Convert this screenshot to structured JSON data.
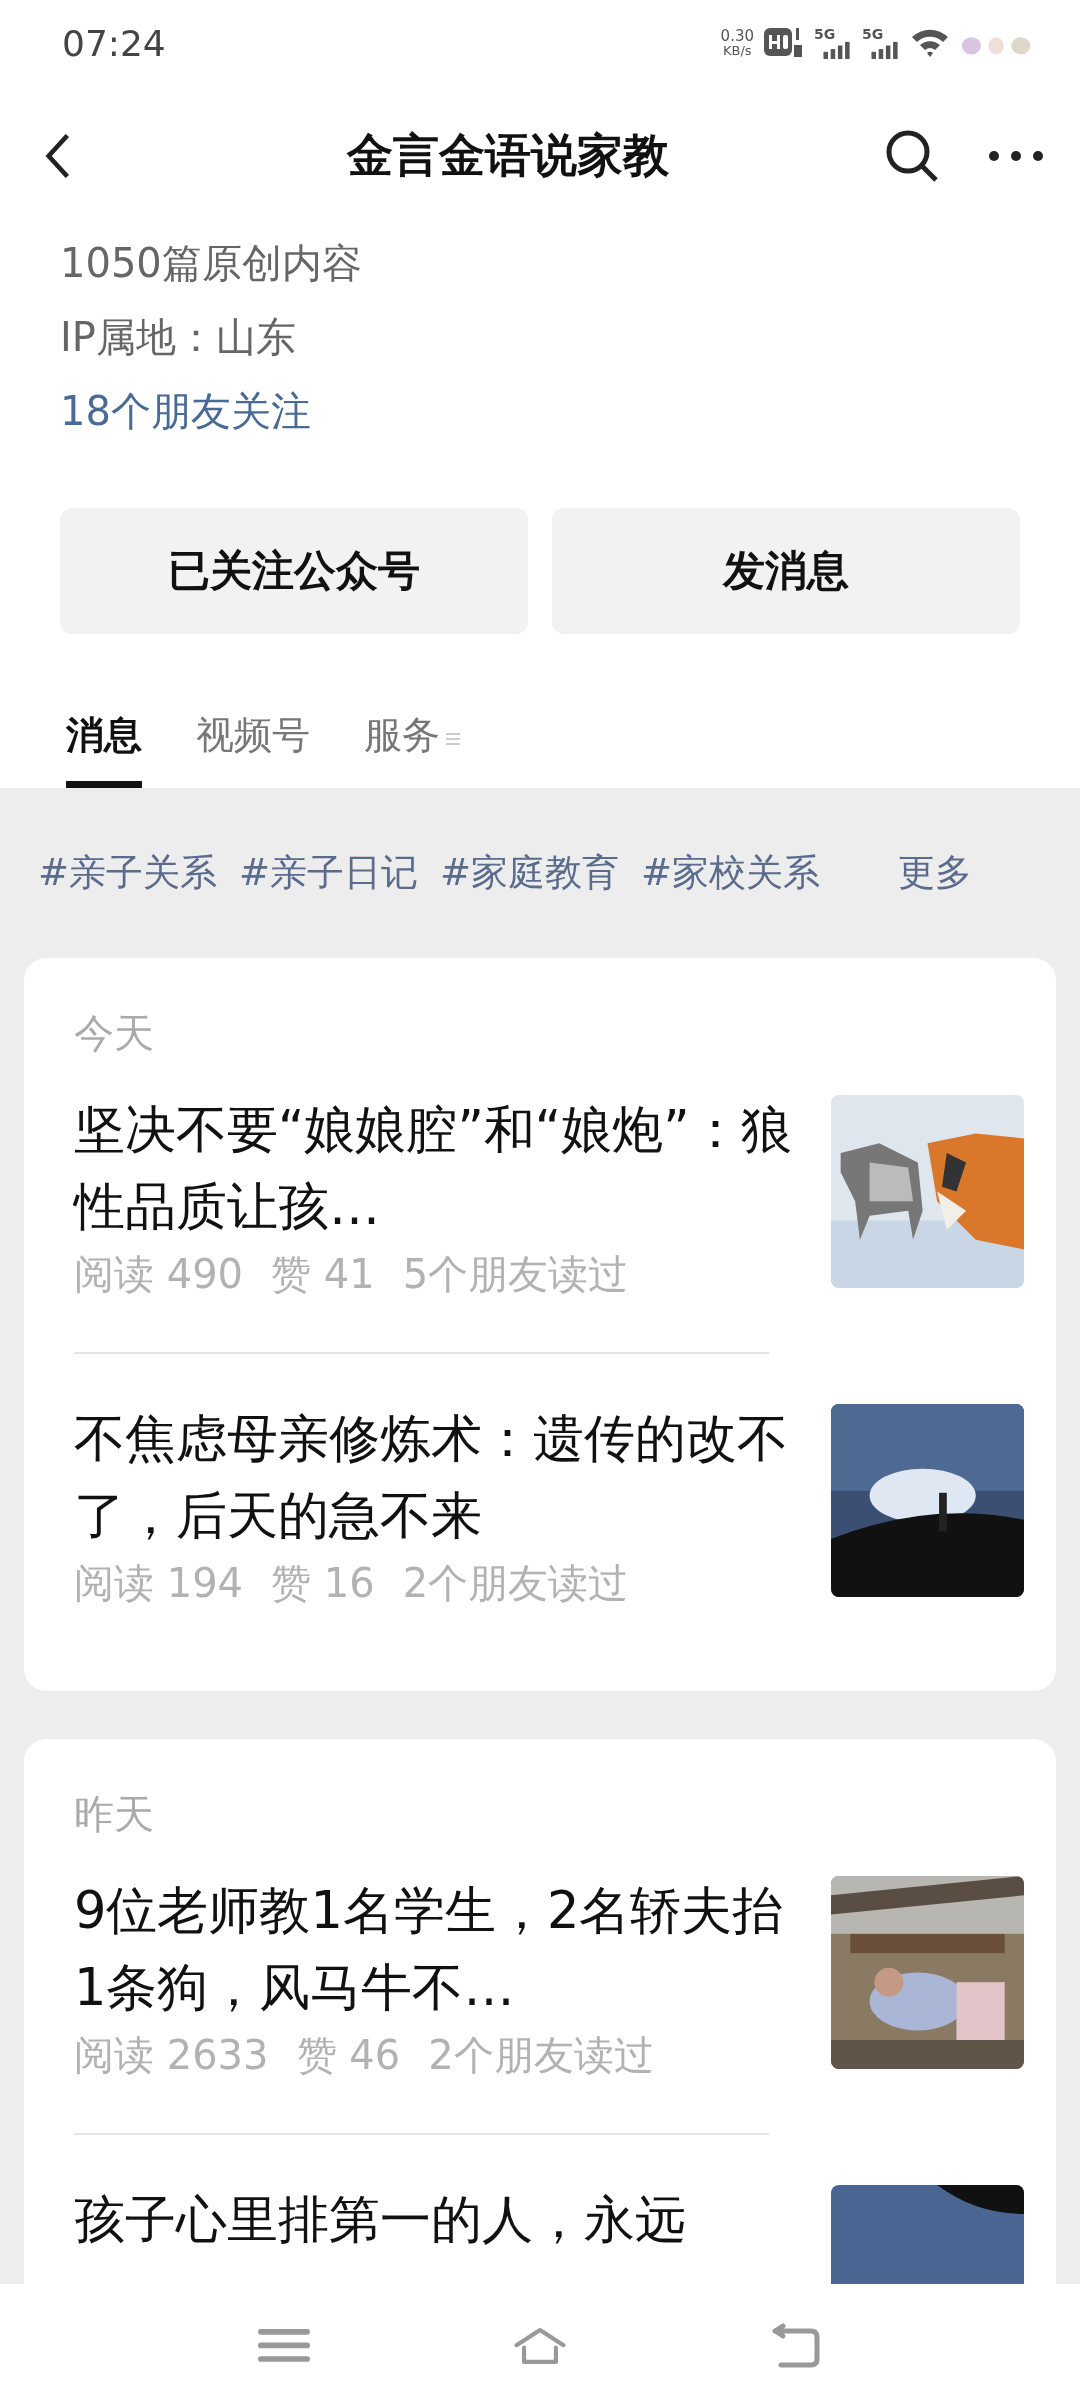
{
  "status_bar": {
    "time": "07:24",
    "speed": "0.30",
    "speed_unit": "KB/s",
    "network_1": "5G",
    "network_2": "5G"
  },
  "header": {
    "title": "金言金语说家教"
  },
  "profile": {
    "articles": "1050篇原创内容",
    "ip": "IP属地：山东",
    "friends": "18个朋友关注"
  },
  "buttons": [
    {
      "label": "已关注公众号"
    },
    {
      "label": "发消息"
    }
  ],
  "tabs": [
    {
      "label": "消息",
      "selected": true
    },
    {
      "label": "视频号",
      "selected": false
    },
    {
      "label": "服务",
      "selected": false
    }
  ],
  "tags": [
    "#亲子关系",
    "#亲子日记",
    "#家庭教育",
    "#家校关系"
  ],
  "more": "更多",
  "groups": [
    {
      "date": "今天",
      "articles": [
        {
          "title": "坚决不要“娘娘腔”和“娘炮”：狼性品质让孩…",
          "reads": "阅读 490",
          "likes": "赞 41",
          "friends": "5个朋友读过",
          "kind": "picture"
        },
        {
          "title": "不焦虑母亲修炼术：遗传的改不了，后天的急不来",
          "reads": "阅读 194",
          "likes": "赞 16",
          "friends": "2个朋友读过",
          "kind": "picture"
        }
      ]
    },
    {
      "date": "昨天",
      "articles": [
        {
          "title": "9位老师教1名学生，2名轿夫抬1条狗，风马牛不…",
          "reads": "阅读 2633",
          "likes": "赞 46",
          "friends": "2个朋友读过",
          "kind": "picture"
        },
        {
          "title": "孩子心里排第一的人，永远",
          "kind": "picture"
        }
      ]
    }
  ]
}
